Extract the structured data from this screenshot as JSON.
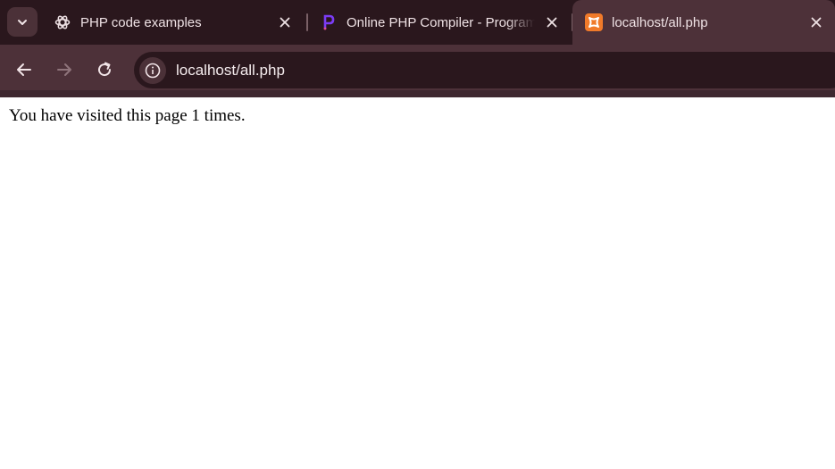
{
  "browser": {
    "tabs": [
      {
        "title": "PHP code examples",
        "icon": "chatgpt-icon",
        "active": false
      },
      {
        "title": "Online PHP Compiler - Programiz",
        "icon": "programiz-icon",
        "active": false
      },
      {
        "title": "localhost/all.php",
        "icon": "xampp-icon",
        "active": true
      }
    ],
    "address_bar": {
      "url": "localhost/all.php"
    }
  },
  "page": {
    "text": "You have visited this page 1 times."
  },
  "colors": {
    "chrome_dark": "#2a171d",
    "chrome_active": "#4d3139",
    "programiz_accent": "#7b3cf5",
    "xampp_accent": "#f07a2a"
  }
}
